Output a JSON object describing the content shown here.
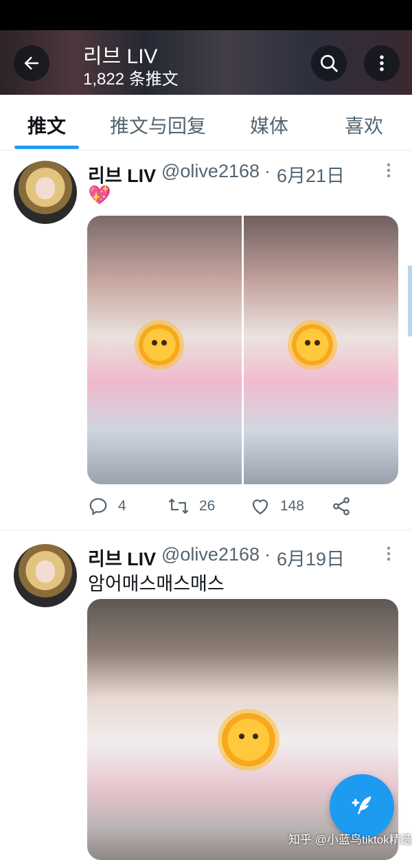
{
  "header": {
    "name": "리브 LIV",
    "tweet_count": "1,822 条推文"
  },
  "tabs": [
    {
      "label": "推文",
      "active": true
    },
    {
      "label": "推文与回复",
      "active": false
    },
    {
      "label": "媒体",
      "active": false
    },
    {
      "label": "喜欢",
      "active": false
    }
  ],
  "tweets": [
    {
      "name": "리브 LIV",
      "handle": "@olive2168",
      "separator": "·",
      "date": "6月21日",
      "text": "💖",
      "image_count": 2,
      "replies": "4",
      "retweets": "26",
      "likes": "148"
    },
    {
      "name": "리브 LIV",
      "handle": "@olive2168",
      "separator": "·",
      "date": "6月19日",
      "text": "암어매스매스매스",
      "image_count": 1
    }
  ],
  "icons": {
    "back": "arrow-left-icon",
    "search": "search-icon",
    "more": "more-vertical-icon",
    "reply": "reply-icon",
    "retweet": "retweet-icon",
    "like": "heart-icon",
    "share": "share-icon",
    "compose": "compose-icon",
    "sticker": "sun-sticker-icon"
  },
  "colors": {
    "accent": "#1d9bf0",
    "text_primary": "#0f1419",
    "text_secondary": "#536471",
    "border": "#e6ecf0"
  },
  "watermark": "知乎 @小蓝鸟tiktok精选"
}
